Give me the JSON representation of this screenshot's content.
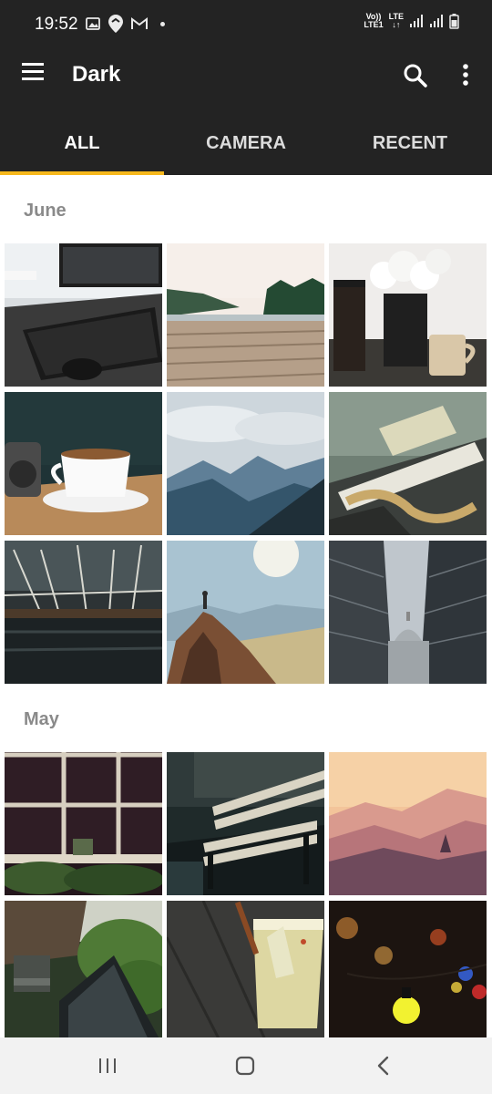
{
  "status_bar": {
    "time": "19:52",
    "left_icons": [
      "gallery-icon",
      "location-pin-icon",
      "gmail-icon",
      "dot-icon"
    ],
    "volte": "Vo))",
    "lte1": "LTE1",
    "lte": "LTE",
    "right_icons": [
      "signal-icon",
      "signal-icon",
      "battery-icon"
    ]
  },
  "app_bar": {
    "title": "Dark",
    "menu_icon": "hamburger-menu-icon",
    "search_icon": "search-icon",
    "more_icon": "more-vertical-icon"
  },
  "tabs": [
    {
      "label": "ALL",
      "active": true
    },
    {
      "label": "CAMERA",
      "active": false
    },
    {
      "label": "RECENT",
      "active": false
    }
  ],
  "colors": {
    "bar_background": "#232323",
    "tab_indicator": "#f6b81c",
    "section_title": "#8a8a8a",
    "content_background": "#ffffff",
    "nav_background": "#f2f2f2"
  },
  "sections": [
    {
      "title": "June",
      "photos": [
        "desk-keyboard",
        "wooden-pier-lake",
        "flowers-coffee",
        "coffee-cup-camera",
        "mountain-valley",
        "notebook-paper",
        "rope-bridge",
        "hiker-cliff",
        "glass-buildings-cathedral"
      ]
    },
    {
      "title": "May",
      "photos": [
        "window-plants",
        "rainy-bench",
        "pink-sunset-hills",
        "park-bench-garden",
        "cocktail-cinnamon",
        "string-lights"
      ]
    }
  ],
  "nav_bar": {
    "recents_icon": "recent-apps-icon",
    "home_icon": "home-icon",
    "back_icon": "back-icon"
  }
}
